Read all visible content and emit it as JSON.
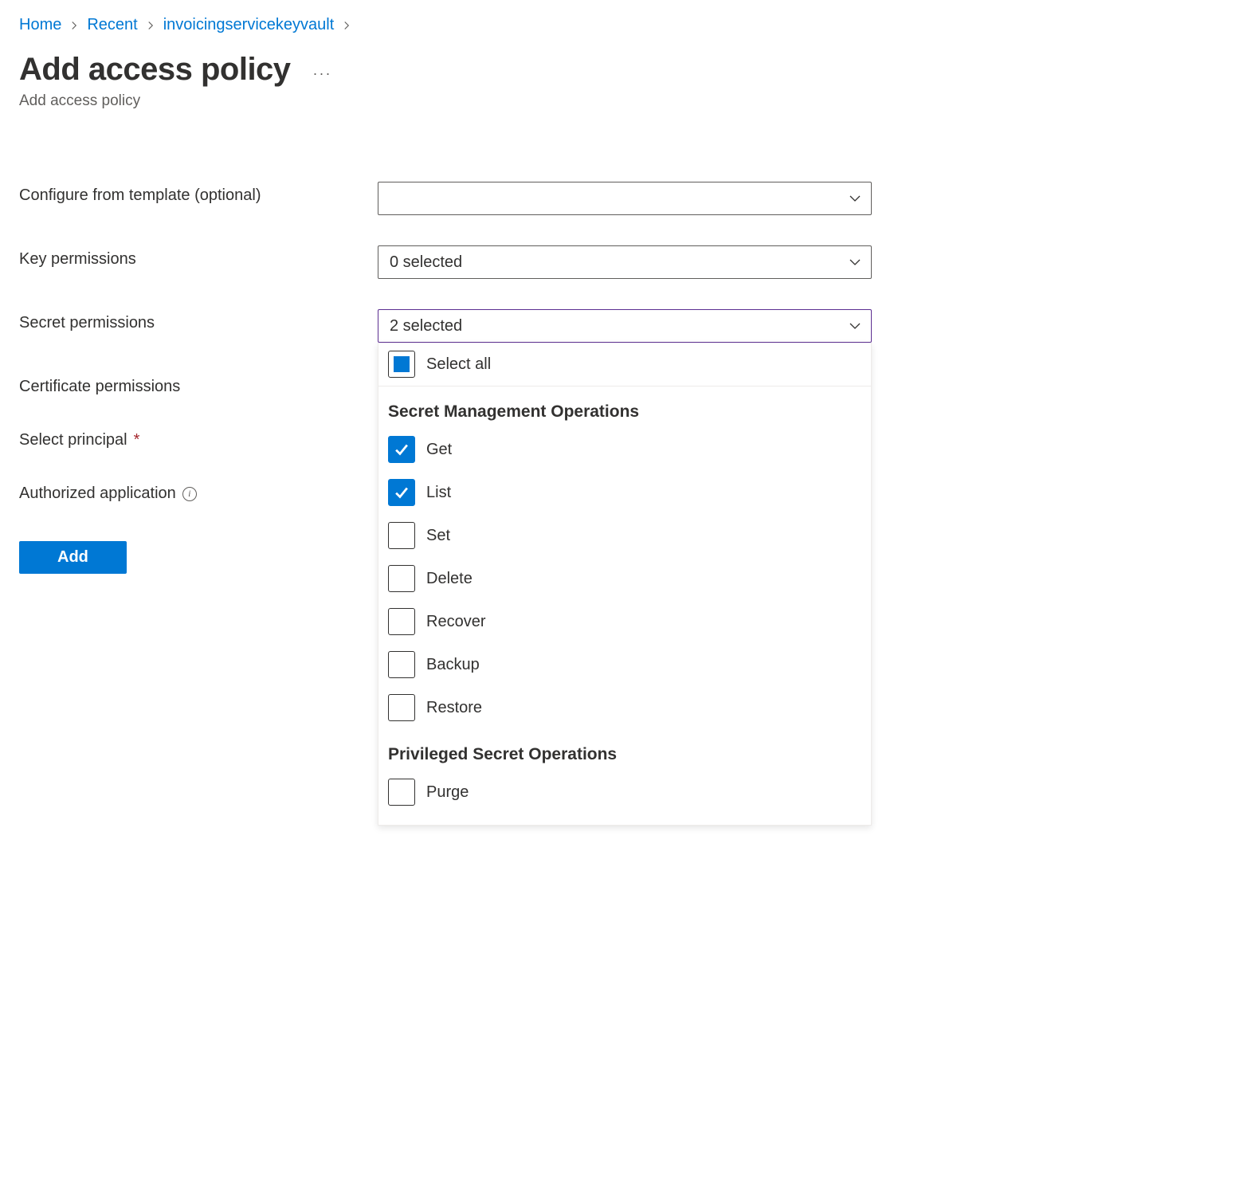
{
  "breadcrumb": {
    "items": [
      {
        "label": "Home"
      },
      {
        "label": "Recent"
      },
      {
        "label": "invoicingservicekeyvault"
      }
    ]
  },
  "header": {
    "title": "Add access policy",
    "subtitle": "Add access policy"
  },
  "form": {
    "template": {
      "label": "Configure from template (optional)",
      "value": ""
    },
    "key_permissions": {
      "label": "Key permissions",
      "value": "0 selected"
    },
    "secret_permissions": {
      "label": "Secret permissions",
      "value": "2 selected",
      "select_all_label": "Select all",
      "groups": [
        {
          "heading": "Secret Management Operations",
          "options": [
            {
              "label": "Get",
              "checked": true
            },
            {
              "label": "List",
              "checked": true
            },
            {
              "label": "Set",
              "checked": false
            },
            {
              "label": "Delete",
              "checked": false
            },
            {
              "label": "Recover",
              "checked": false
            },
            {
              "label": "Backup",
              "checked": false
            },
            {
              "label": "Restore",
              "checked": false
            }
          ]
        },
        {
          "heading": "Privileged Secret Operations",
          "options": [
            {
              "label": "Purge",
              "checked": false
            }
          ]
        }
      ]
    },
    "certificate_permissions": {
      "label": "Certificate permissions"
    },
    "select_principal": {
      "label": "Select principal"
    },
    "authorized_application": {
      "label": "Authorized application"
    },
    "add_button": "Add"
  }
}
